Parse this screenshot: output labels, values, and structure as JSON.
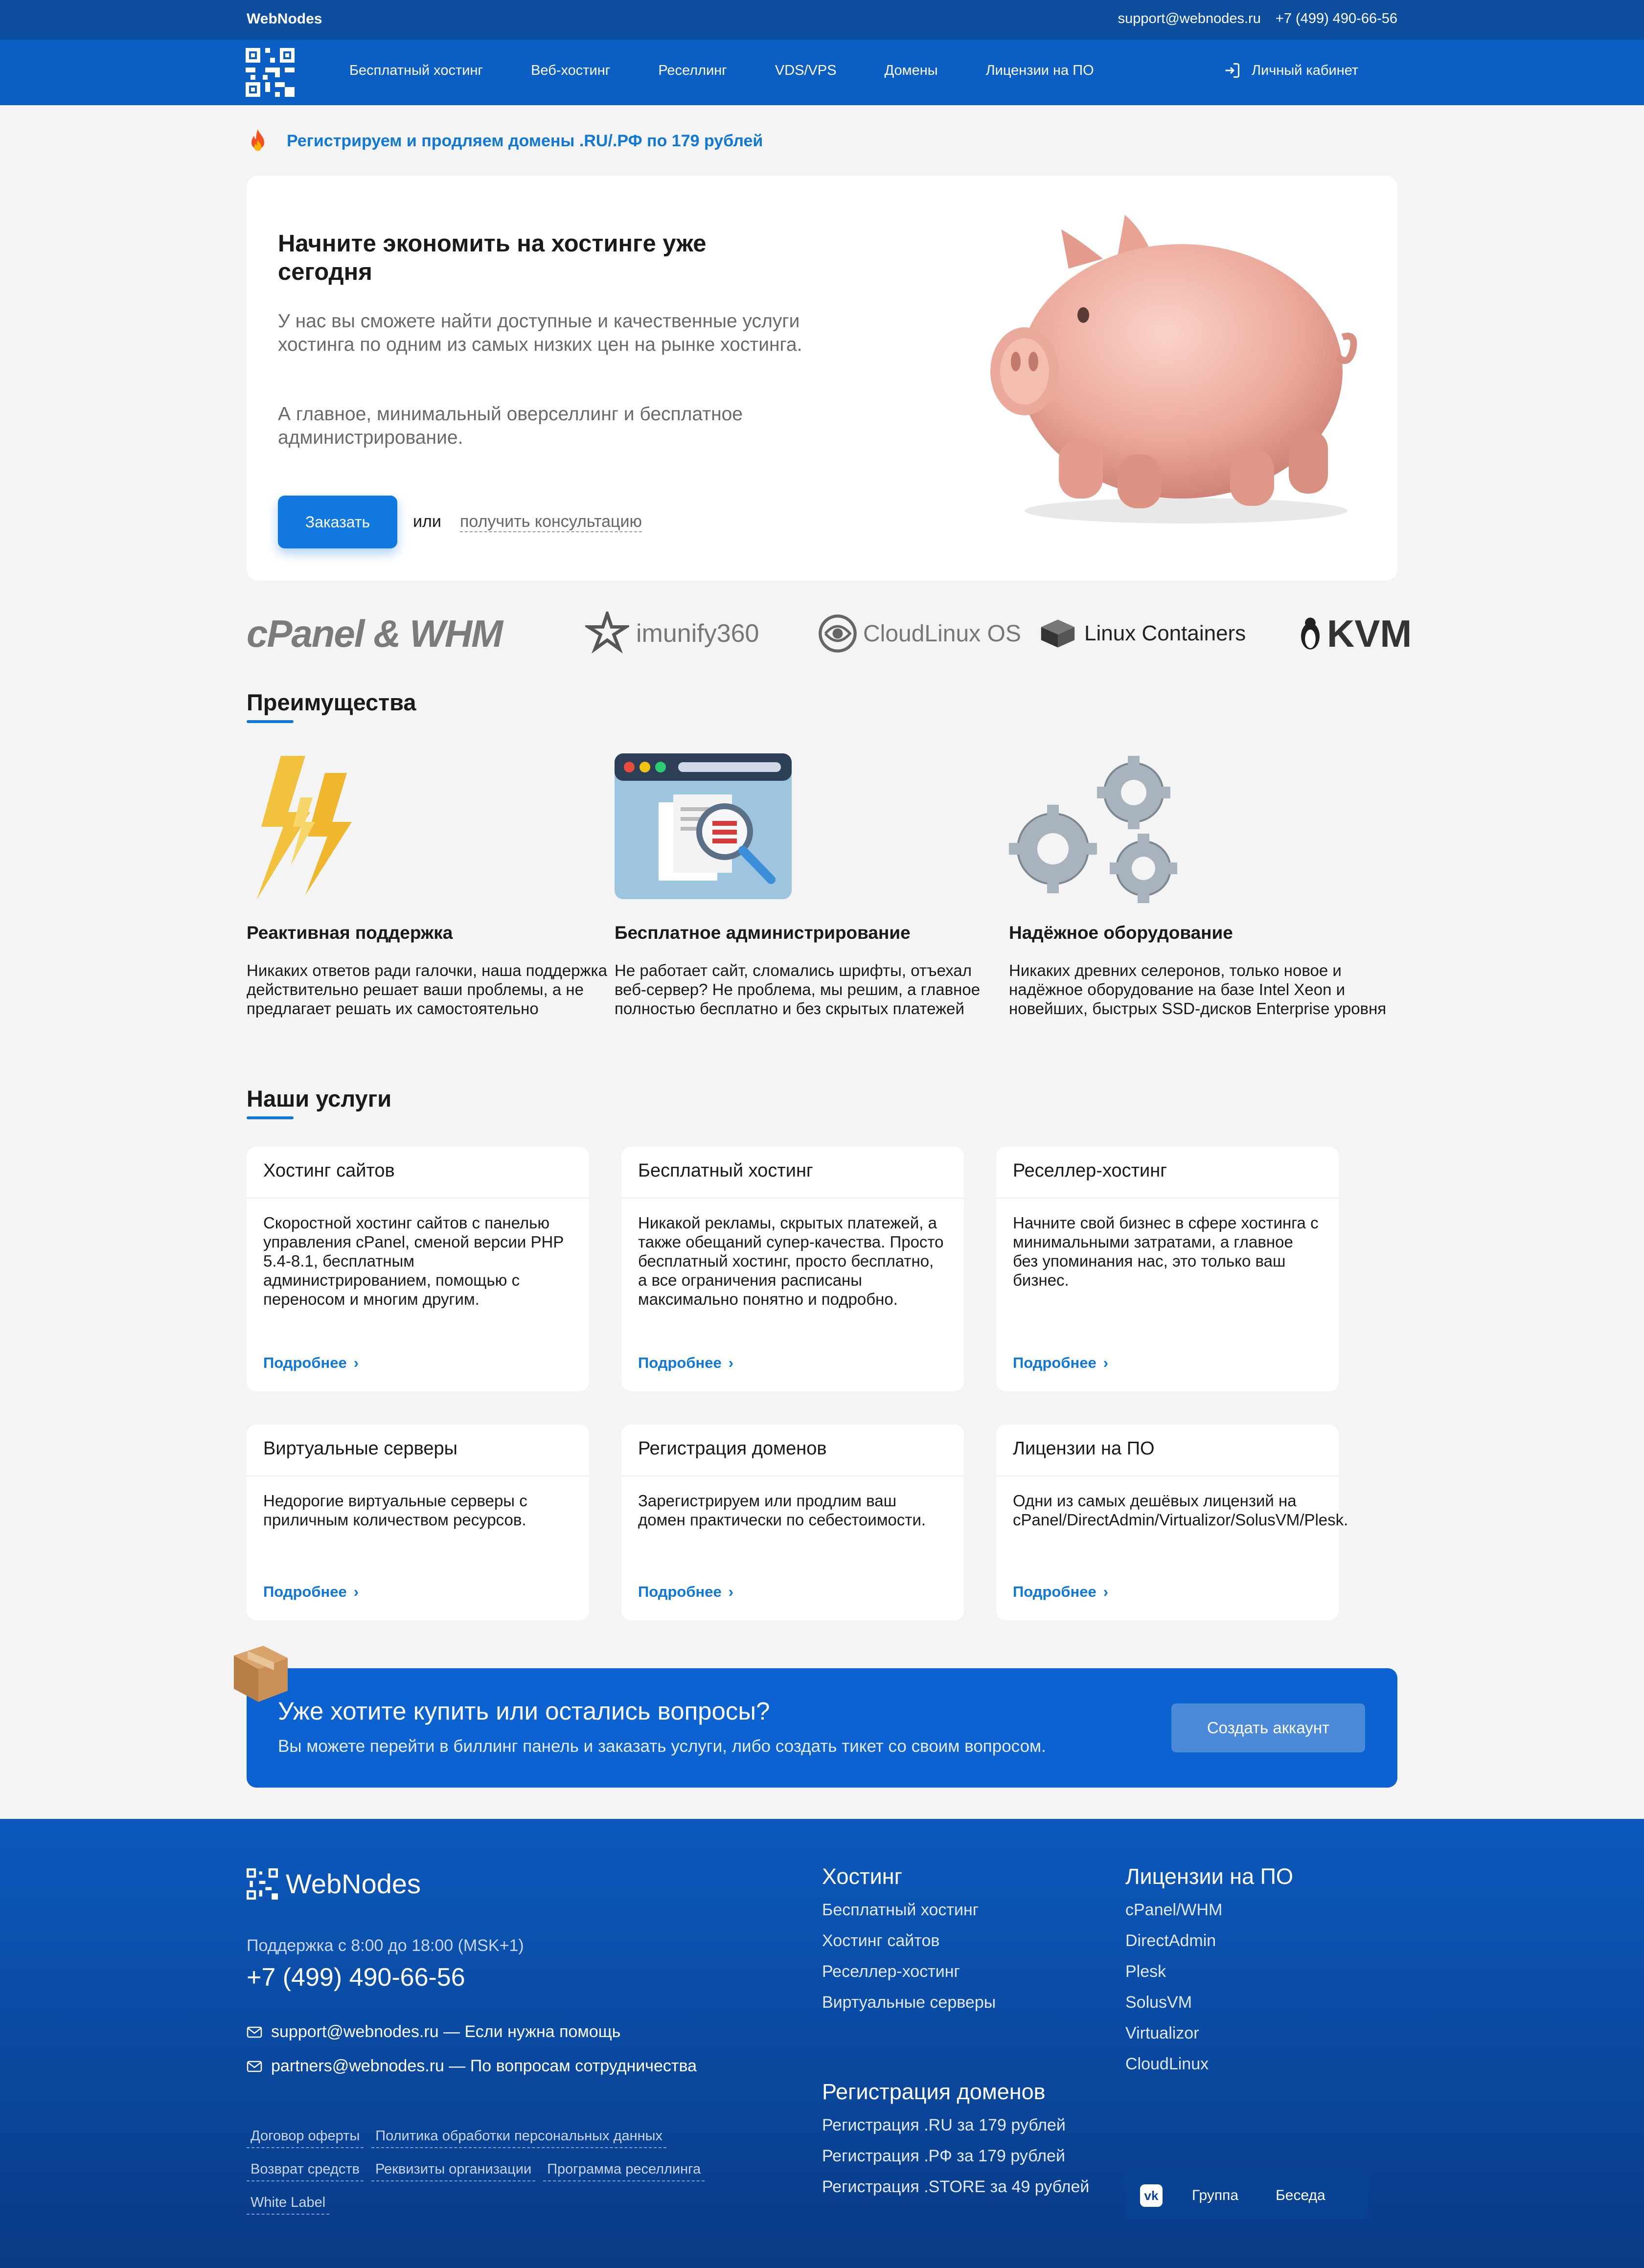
{
  "topbar": {
    "brand": "WebNodes",
    "email": "support@webnodes.ru",
    "phone": "+7 (499) 490-66-56"
  },
  "nav": {
    "items": [
      "Бесплатный хостинг",
      "Веб-хостинг",
      "Реселлинг",
      "VDS/VPS",
      "Домены",
      "Лицензии на ПО"
    ],
    "login": "Личный кабинет"
  },
  "promo": {
    "text": "Регистрируем и продляем домены .RU/.РФ по 179 рублей"
  },
  "hero": {
    "title": "Начните экономить на хостинге уже сегодня",
    "p1": "У нас вы сможете найти доступные и качественные услуги хостинга по одним из самых низких цен на рынке хостинга.",
    "p2": "А главное, минимальный оверселлинг и бесплатное администрирование.",
    "order_button": "Заказать",
    "or": "или",
    "consult_link": "получить консультацию"
  },
  "partners": {
    "cpanel": "cPanel & WHM",
    "imunify": "imunify360",
    "cloudlinux": "CloudLinux OS",
    "lxc": "Linux Containers",
    "kvm": "KVM"
  },
  "advantages": {
    "title": "Преимущества",
    "items": [
      {
        "title": "Реактивная поддержка",
        "text": "Никаких ответов ради галочки, наша поддержка действительно решает ваши проблемы, а не предлагает решать их самостоятельно"
      },
      {
        "title": "Бесплатное администрирование",
        "text": "Не работает сайт, сломались шрифты, отъехал веб-сервер? Не проблема, мы решим, а главное полностью бесплатно и без скрытых платежей"
      },
      {
        "title": "Надёжное оборудование",
        "text": "Никаких древних селеронов, только новое и надёжное оборудование на базе Intel Xeon и новейших, быстрых SSD-дисков Enterprise уровня"
      }
    ]
  },
  "services": {
    "title": "Наши услуги",
    "more": "Подробнее",
    "items": [
      {
        "title": "Хостинг сайтов",
        "text": "Скоростной хостинг сайтов с панелью управления cPanel, сменой версии PHP 5.4-8.1, бесплатным администрированием, помощью с переносом и многим другим."
      },
      {
        "title": "Бесплатный хостинг",
        "text": "Никакой рекламы, скрытых платежей, а также обещаний супер-качества. Просто бесплатный хостинг, просто бесплатно, а все ограничения расписаны максимально понятно и подробно."
      },
      {
        "title": "Реселлер-хостинг",
        "text": "Начните свой бизнес в сфере хостинга с минимальными затратами, а главное без упоминания нас, это только ваш бизнес."
      },
      {
        "title": "Виртуальные серверы",
        "text": "Недорогие виртуальные серверы с приличным количеством ресурсов."
      },
      {
        "title": "Регистрация доменов",
        "text": "Зарегистрируем или продлим ваш домен практически по себестоимости."
      },
      {
        "title": "Лицензии на ПО",
        "text": "Одни из самых дешёвых лицензий на cPanel/DirectAdmin/Virtualizor/SolusVM/Plesk."
      }
    ]
  },
  "cta": {
    "title": "Уже хотите купить или остались вопросы?",
    "text": "Вы можете перейти в биллинг панель и заказать услуги, либо создать тикет со своим вопросом.",
    "button": "Создать аккаунт"
  },
  "footer": {
    "brand": "WebNodes",
    "hours": "Поддержка с 8:00 до 18:00 (MSK+1)",
    "phone": "+7 (499) 490-66-56",
    "mail1": "support@webnodes.ru — Если нужна помощь",
    "mail2": "partners@webnodes.ru — По вопросам сотрудничества",
    "legal_row1": [
      "Договор оферты",
      "Политика обработки персональных данных"
    ],
    "legal_row2": [
      "Возврат средств",
      "Реквизиты организации",
      "Программа реселлинга"
    ],
    "legal_row3": [
      "White Label"
    ],
    "hosting": {
      "title": "Хостинг",
      "links": [
        "Бесплатный хостинг",
        "Хостинг сайтов",
        "Реселлер-хостинг",
        "Виртуальные серверы"
      ]
    },
    "domains": {
      "title": "Регистрация доменов",
      "links": [
        "Регистрация .RU за 179 рублей",
        "Регистрация .РФ за 179 рублей",
        "Регистрация .STORE за 49 рублей"
      ]
    },
    "licenses": {
      "title": "Лицензии на ПО",
      "links": [
        "cPanel/WHM",
        "DirectAdmin",
        "Plesk",
        "SolusVM",
        "Virtualizor",
        "CloudLinux"
      ]
    },
    "social": {
      "vk": "vk",
      "group": "Группа",
      "chat": "Беседа"
    }
  },
  "colors": {
    "topbar": "#0d4e9e",
    "nav": "#0b5fc4",
    "accent": "#1178d8",
    "cta": "#0b62d0"
  }
}
